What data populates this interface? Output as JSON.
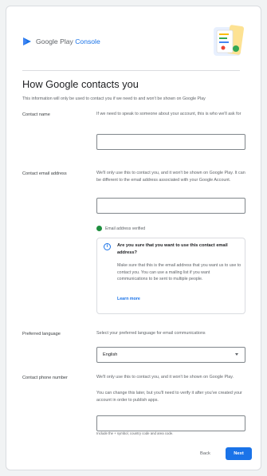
{
  "header": {
    "logo_text_main": "Google Play ",
    "logo_text_accent": "Console"
  },
  "page": {
    "title": "How Google contacts you",
    "subtitle": "This information will only be used to contact you if we need to and won't be shown on Google Play"
  },
  "contact_name": {
    "label": "Contact name",
    "description": "If we need to speak to someone about your account, this is who we'll ask for",
    "value": ""
  },
  "contact_email": {
    "label": "Contact email address",
    "description": "We'll only use this to contact you, and it won't be shown on Google Play. It can be different to the email address associated with your Google Account.",
    "value": "",
    "verified_text": "Email address verified",
    "info": {
      "title": "Are you sure that you want to use this contact email address?",
      "body": "Make sure that this is the email address that you want us to use to contact you. You can use a mailing list if you want communications to be sent to multiple people.",
      "link": "Learn more"
    }
  },
  "language": {
    "label": "Preferred language",
    "description": "Select your preferred language for email communications",
    "selected": "English"
  },
  "phone": {
    "label": "Contact phone number",
    "description": "We'll only use this to contact you, and it won't be shown on Google Play.",
    "description2": "You can change this later, but you'll need to verify it after you've created your account in order to publish apps.",
    "value": "",
    "hint": "Include the + symbol, country code and area code."
  },
  "footer": {
    "back_label": "Back",
    "next_label": "Next"
  },
  "colors": {
    "accent": "#1a73e8",
    "verified": "#1e8e3e"
  }
}
